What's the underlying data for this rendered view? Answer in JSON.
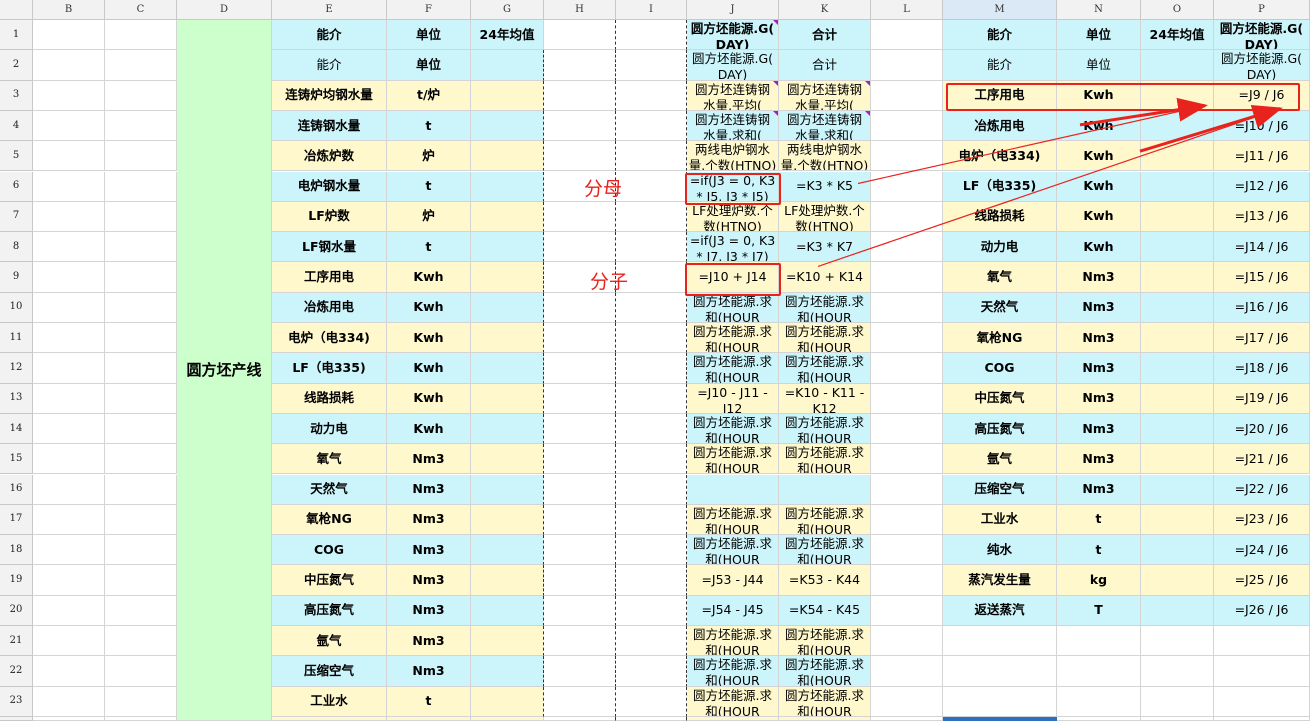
{
  "columns": {
    "A": "",
    "B": "B",
    "C": "C",
    "D": "D",
    "E": "E",
    "F": "F",
    "G": "G",
    "H": "H",
    "I": "I",
    "J": "J",
    "K": "K",
    "L": "L",
    "M": "M",
    "N": "N",
    "O": "O",
    "P": "P"
  },
  "rows": [
    "1",
    "2",
    "3",
    "4",
    "5",
    "6",
    "7",
    "8",
    "9",
    "10",
    "11",
    "12",
    "13",
    "14",
    "15",
    "16",
    "17",
    "18",
    "19",
    "20",
    "21",
    "22",
    "23"
  ],
  "d_merged_label": "圆方坯产线",
  "left_table": {
    "header": {
      "name": "能介",
      "unit": "单位",
      "avg": "24年均值"
    },
    "rows": [
      {
        "name": "能介",
        "unit": "单位"
      },
      {
        "name": "连铸炉均钢水量",
        "unit": "t/炉"
      },
      {
        "name": "连铸钢水量",
        "unit": "t"
      },
      {
        "name": "冶炼炉数",
        "unit": "炉"
      },
      {
        "name": "电炉钢水量",
        "unit": "t"
      },
      {
        "name": "LF炉数",
        "unit": "炉"
      },
      {
        "name": "LF钢水量",
        "unit": "t"
      },
      {
        "name": "工序用电",
        "unit": "Kwh"
      },
      {
        "name": "冶炼用电",
        "unit": "Kwh"
      },
      {
        "name": "电炉（电334)",
        "unit": "Kwh"
      },
      {
        "name": "LF（电335)",
        "unit": "Kwh"
      },
      {
        "name": "线路损耗",
        "unit": "Kwh"
      },
      {
        "name": "动力电",
        "unit": "Kwh"
      },
      {
        "name": "氧气",
        "unit": "Nm3"
      },
      {
        "name": "天然气",
        "unit": "Nm3"
      },
      {
        "name": "氧枪NG",
        "unit": "Nm3"
      },
      {
        "name": "COG",
        "unit": "Nm3"
      },
      {
        "name": "中压氮气",
        "unit": "Nm3"
      },
      {
        "name": "高压氮气",
        "unit": "Nm3"
      },
      {
        "name": "氩气",
        "unit": "Nm3"
      },
      {
        "name": "压缩空气",
        "unit": "Nm3"
      },
      {
        "name": "工业水",
        "unit": "t"
      }
    ]
  },
  "formula_table": {
    "header": {
      "j": "圆方坯能源.G(\nDAY)",
      "k": "合计"
    },
    "rows": [
      {
        "j": "圆方坯能源.G(\nDAY)",
        "k": "合计"
      },
      {
        "j": "圆方坯连铸钢\n水量.平均(",
        "k": "圆方坯连铸钢\n水量.平均("
      },
      {
        "j": "圆方坯连铸钢\n水量.求和(",
        "k": "圆方坯连铸钢\n水量.求和("
      },
      {
        "j": "两线电炉钢水\n量.个数(HTNO)",
        "k": "两线电炉钢水\n量.个数(HTNO)"
      },
      {
        "j": "=if(J3 = 0, K3\n* J5, J3 * J5)",
        "k": "=K3 * K5"
      },
      {
        "j": "LF处理炉数.个\n数(HTNO)",
        "k": "LF处理炉数.个\n数(HTNO)"
      },
      {
        "j": "=if(J3 = 0, K3\n* J7, J3 * J7)",
        "k": "=K3 * K7"
      },
      {
        "j": "=J10 + J14",
        "k": "=K10 + K14"
      },
      {
        "j": "圆方坯能源.求\n和(HOUR",
        "k": "圆方坯能源.求\n和(HOUR"
      },
      {
        "j": "圆方坯能源.求\n和(HOUR",
        "k": "圆方坯能源.求\n和(HOUR"
      },
      {
        "j": "圆方坯能源.求\n和(HOUR",
        "k": "圆方坯能源.求\n和(HOUR"
      },
      {
        "j": "=J10 - J11 -\nJ12",
        "k": "=K10 - K11 -\nK12"
      },
      {
        "j": "圆方坯能源.求\n和(HOUR",
        "k": "圆方坯能源.求\n和(HOUR"
      },
      {
        "j": "圆方坯能源.求\n和(HOUR",
        "k": "圆方坯能源.求\n和(HOUR"
      },
      {
        "j": "",
        "k": ""
      },
      {
        "j": "圆方坯能源.求\n和(HOUR",
        "k": "圆方坯能源.求\n和(HOUR"
      },
      {
        "j": "圆方坯能源.求\n和(HOUR",
        "k": "圆方坯能源.求\n和(HOUR"
      },
      {
        "j": "=J53 - J44",
        "k": "=K53 - K44"
      },
      {
        "j": "=J54 - J45",
        "k": "=K54 - K45"
      },
      {
        "j": "圆方坯能源.求\n和(HOUR",
        "k": "圆方坯能源.求\n和(HOUR"
      },
      {
        "j": "圆方坯能源.求\n和(HOUR",
        "k": "圆方坯能源.求\n和(HOUR"
      },
      {
        "j": "圆方坯能源.求\n和(HOUR",
        "k": "圆方坯能源.求\n和(HOUR"
      }
    ]
  },
  "right_table": {
    "header": {
      "name": "能介",
      "unit": "单位",
      "avg": "24年均值",
      "p": "圆方坯能源.G(\nDAY)"
    },
    "rows": [
      {
        "name": "能介",
        "unit": "单位",
        "p": "圆方坯能源.G(\nDAY)"
      },
      {
        "name": "工序用电",
        "unit": "Kwh",
        "p": "=J9 / J6"
      },
      {
        "name": "冶炼用电",
        "unit": "Kwh",
        "p": "=J10 / J6"
      },
      {
        "name": "电炉（电334)",
        "unit": "Kwh",
        "p": "=J11 / J6"
      },
      {
        "name": "LF（电335)",
        "unit": "Kwh",
        "p": "=J12 / J6"
      },
      {
        "name": "线路损耗",
        "unit": "Kwh",
        "p": "=J13 / J6"
      },
      {
        "name": "动力电",
        "unit": "Kwh",
        "p": "=J14 / J6"
      },
      {
        "name": "氧气",
        "unit": "Nm3",
        "p": "=J15 / J6"
      },
      {
        "name": "天然气",
        "unit": "Nm3",
        "p": "=J16 / J6"
      },
      {
        "name": "氧枪NG",
        "unit": "Nm3",
        "p": "=J17 / J6"
      },
      {
        "name": "COG",
        "unit": "Nm3",
        "p": "=J18 / J6"
      },
      {
        "name": "中压氮气",
        "unit": "Nm3",
        "p": "=J19 / J6"
      },
      {
        "name": "高压氮气",
        "unit": "Nm3",
        "p": "=J20 / J6"
      },
      {
        "name": "氩气",
        "unit": "Nm3",
        "p": "=J21 / J6"
      },
      {
        "name": "压缩空气",
        "unit": "Nm3",
        "p": "=J22 / J6"
      },
      {
        "name": "工业水",
        "unit": "t",
        "p": "=J23 / J6"
      },
      {
        "name": "纯水",
        "unit": "t",
        "p": "=J24 / J6"
      },
      {
        "name": "蒸汽发生量",
        "unit": "kg",
        "p": "=J25 / J6"
      },
      {
        "name": "返送蒸汽",
        "unit": "T",
        "p": "=J26 / J6"
      }
    ]
  },
  "annotations": {
    "denominator": "分母",
    "numerator": "分子"
  },
  "colors": {
    "cyan": "#ccf5fb",
    "yellow": "#fff8cc",
    "green": "#ccffcc",
    "highlight": "#e8231d"
  }
}
